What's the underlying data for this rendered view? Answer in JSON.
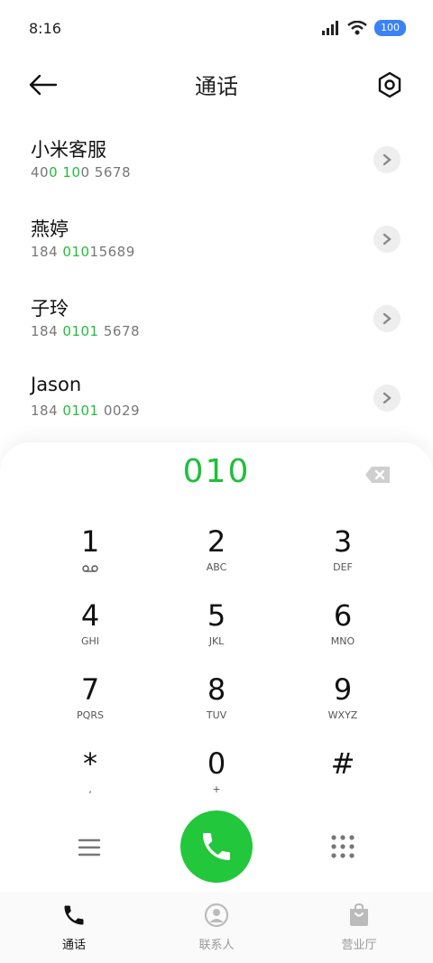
{
  "status_bar": {
    "time": "8:16",
    "battery": "100"
  },
  "header": {
    "title": "通话"
  },
  "contacts": [
    {
      "name": "小米客服",
      "number_prefix": "40",
      "number_match": "0 10",
      "number_suffix": "0 5678"
    },
    {
      "name": "燕婷",
      "number_prefix": "184 ",
      "number_match": "010",
      "number_suffix": "15689"
    },
    {
      "name": "子玲",
      "number_prefix": "184 ",
      "number_match": "0101",
      "number_suffix": " 5678"
    },
    {
      "name": "Jason",
      "number_prefix": "184 ",
      "number_match": "0101",
      "number_suffix": " 0029"
    }
  ],
  "dialer": {
    "input": "010",
    "keys": [
      {
        "digit": "1",
        "letters": ""
      },
      {
        "digit": "2",
        "letters": "ABC"
      },
      {
        "digit": "3",
        "letters": "DEF"
      },
      {
        "digit": "4",
        "letters": "GHI"
      },
      {
        "digit": "5",
        "letters": "JKL"
      },
      {
        "digit": "6",
        "letters": "MNO"
      },
      {
        "digit": "7",
        "letters": "PQRS"
      },
      {
        "digit": "8",
        "letters": "TUV"
      },
      {
        "digit": "9",
        "letters": "WXYZ"
      },
      {
        "digit": "*",
        "letters": ","
      },
      {
        "digit": "0",
        "letters": "+"
      },
      {
        "digit": "#",
        "letters": ""
      }
    ]
  },
  "tabs": [
    {
      "label": "通话",
      "icon": "phone-icon",
      "active": true
    },
    {
      "label": "联系人",
      "icon": "person-icon",
      "active": false
    },
    {
      "label": "营业厅",
      "icon": "shopping-bag-icon",
      "active": false
    }
  ],
  "colors": {
    "accent": "#22c73b",
    "highlight": "#1fbf3a",
    "battery": "#3b82f6"
  }
}
